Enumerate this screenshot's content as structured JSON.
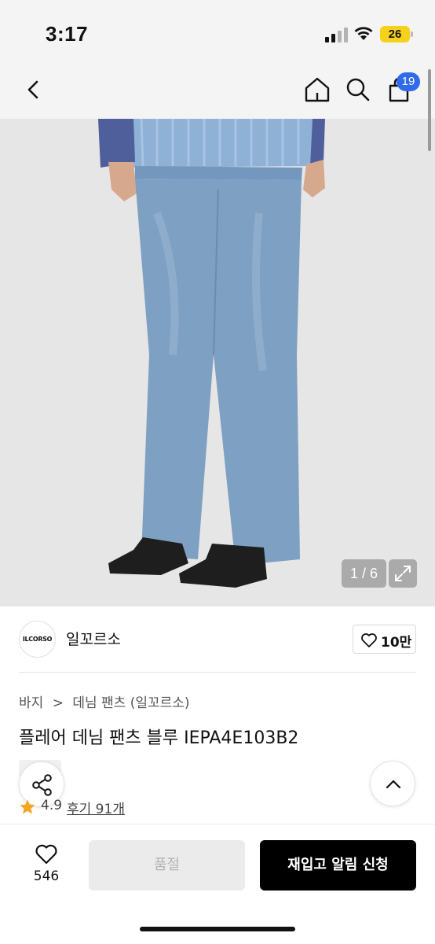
{
  "status_bar": {
    "time": "3:17",
    "battery": "26",
    "icons": [
      "cellular-signal-icon",
      "wifi-icon",
      "battery-icon"
    ]
  },
  "nav": {
    "icons": [
      "back-arrow-icon",
      "home-icon",
      "search-icon",
      "shopping-bag-icon"
    ],
    "cart_count": "19"
  },
  "product_image": {
    "counter": "1 / 6",
    "expand_icon": "expand-icon",
    "description_colors": {
      "background": "#e6e6e6",
      "denim": "#7ea0c3",
      "jacket": "#4f5f9c",
      "shirt": "#8fb1d6",
      "boots": "#1e1e1e"
    }
  },
  "brand": {
    "logo_text": "ILCORSO",
    "name": "일꼬르소",
    "like_count": "10만"
  },
  "breadcrumb": {
    "items": [
      "바지",
      "데님 팬츠 (일꼬르소)"
    ],
    "separator": ">"
  },
  "product": {
    "title": "플레어 데님 팬츠 블루 IEPA4E103B2",
    "rating": "4.9",
    "reviews_label": "후기 91개"
  },
  "bottom_bar": {
    "wish_count": "546",
    "soldout_label": "품절",
    "restock_label": "재입고 알림 신청"
  },
  "colors": {
    "accent_badge": "#2f6bea",
    "star": "#f5a623",
    "primary_button": "#000000",
    "disabled_button": "#ebebeb"
  }
}
